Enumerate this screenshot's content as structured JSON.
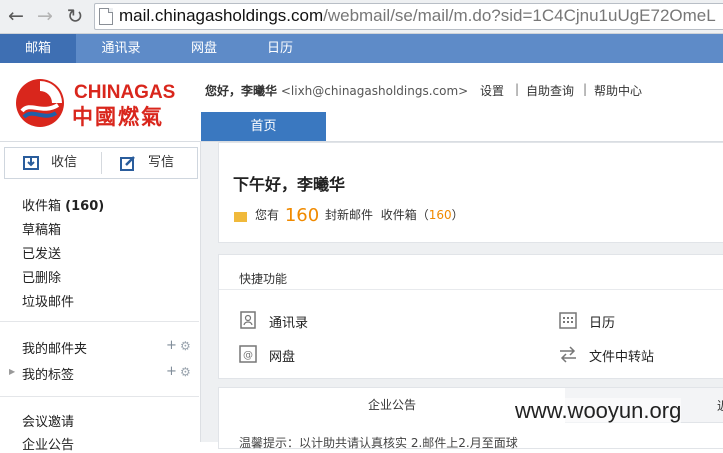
{
  "browser": {
    "url_host": "mail.chinagasholdings.com",
    "url_path": "/webmail/se/mail/m.do?sid=1C4Cjnu1uUgE72OmeL"
  },
  "topnav": {
    "items": [
      "邮箱",
      "通讯录",
      "网盘",
      "日历"
    ]
  },
  "header": {
    "logo_en": "CHINAGAS",
    "logo_cn": "中國燃氣",
    "greeting_prefix": "您好，",
    "user_name": "李曦华",
    "user_email": "<lixh@chinagasholdings.com>",
    "links": [
      "设置",
      "自助查询",
      "帮助中心"
    ],
    "home_tab": "首页"
  },
  "sidebar": {
    "receive_label": "收信",
    "write_label": "写信",
    "inbox_label": "收件箱",
    "inbox_count": "(160)",
    "folders": [
      "草稿箱",
      "已发送",
      "已删除",
      "垃圾邮件"
    ],
    "my_folders": "我的邮件夹",
    "my_tags": "我的标签",
    "meeting": "会议邀请",
    "announce": "企业公告"
  },
  "main": {
    "greeting": "下午好，李曦华",
    "you_have": "您有",
    "unread_count": "160",
    "new_mail": "封新邮件",
    "inbox_label": "收件箱（",
    "inbox_count": "160",
    "inbox_close": "）",
    "quick_title": "快捷功能",
    "quick_items": [
      "通讯录",
      "日历",
      "网盘",
      "文件中转站"
    ],
    "notice_tab": "企业公告",
    "notice_tab2": "近",
    "notice_text": "温馨提示：以计助共请认真核实 2.邮件上2.月至面球"
  },
  "watermark": "www.wooyun.org",
  "colors": {
    "nav_bg": "#5e8bc8",
    "home_tab": "#3a78c0",
    "accent_orange": "#f08a00",
    "logo_red": "#d9261c"
  }
}
